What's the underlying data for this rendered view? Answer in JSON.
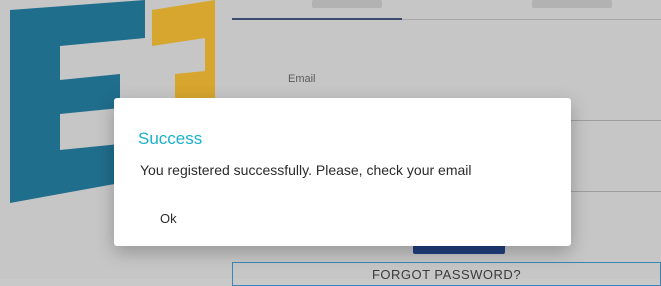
{
  "background": {
    "email_label": "Email",
    "forgot_password_label": "FORGOT PASSWORD?"
  },
  "modal": {
    "title": "Success",
    "message": "You registered successfully. Please, check your email",
    "ok_label": "Ok"
  },
  "colors": {
    "logo_blue": "#1f6e8c",
    "logo_gold": "#d7a62e",
    "title_cyan": "#1ab1c8",
    "primary_button": "#1f3f7e"
  },
  "icons": {
    "logo": "ee-logo"
  }
}
